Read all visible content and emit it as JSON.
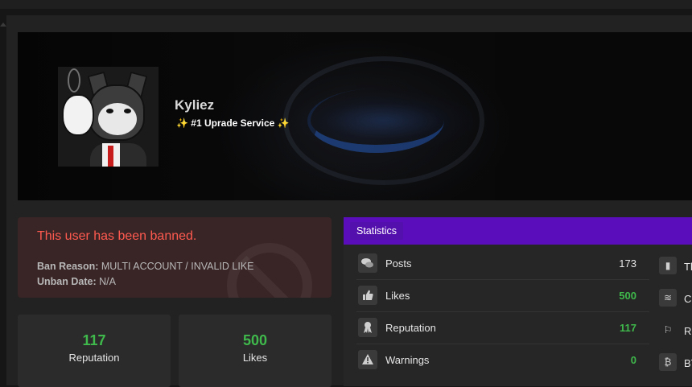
{
  "profile": {
    "username": "Kyliez",
    "title_text": "#1 Uprade Service",
    "title_sparkle": "✨"
  },
  "ban": {
    "heading": "This user has been banned.",
    "reason_label": "Ban Reason:",
    "reason_value": "MULTI ACCOUNT / INVALID LIKE",
    "unban_label": "Unban Date:",
    "unban_value": "N/A"
  },
  "mini_stats": [
    {
      "value": "117",
      "label": "Reputation"
    },
    {
      "value": "500",
      "label": "Likes"
    }
  ],
  "statistics": {
    "heading": "Statistics",
    "rows": [
      {
        "icon": "comments-icon",
        "label": "Posts",
        "value": "173"
      },
      {
        "icon": "thumbs-up-icon",
        "label": "Likes",
        "value": "500"
      },
      {
        "icon": "award-icon",
        "label": "Reputation",
        "value": "117"
      },
      {
        "icon": "warning-icon",
        "label": "Warnings",
        "value": "0"
      }
    ],
    "right_rows": [
      {
        "icon": "book-icon",
        "label": "Th"
      },
      {
        "icon": "coins-icon",
        "label": "Cr"
      },
      {
        "icon": "flag-icon",
        "label": "Re"
      },
      {
        "icon": "bitcoin-icon",
        "label": "BT"
      }
    ]
  },
  "colors": {
    "accent_purple": "#5a0dbb",
    "ban_red": "#ff5a4f",
    "positive_green": "#3fb94b"
  }
}
